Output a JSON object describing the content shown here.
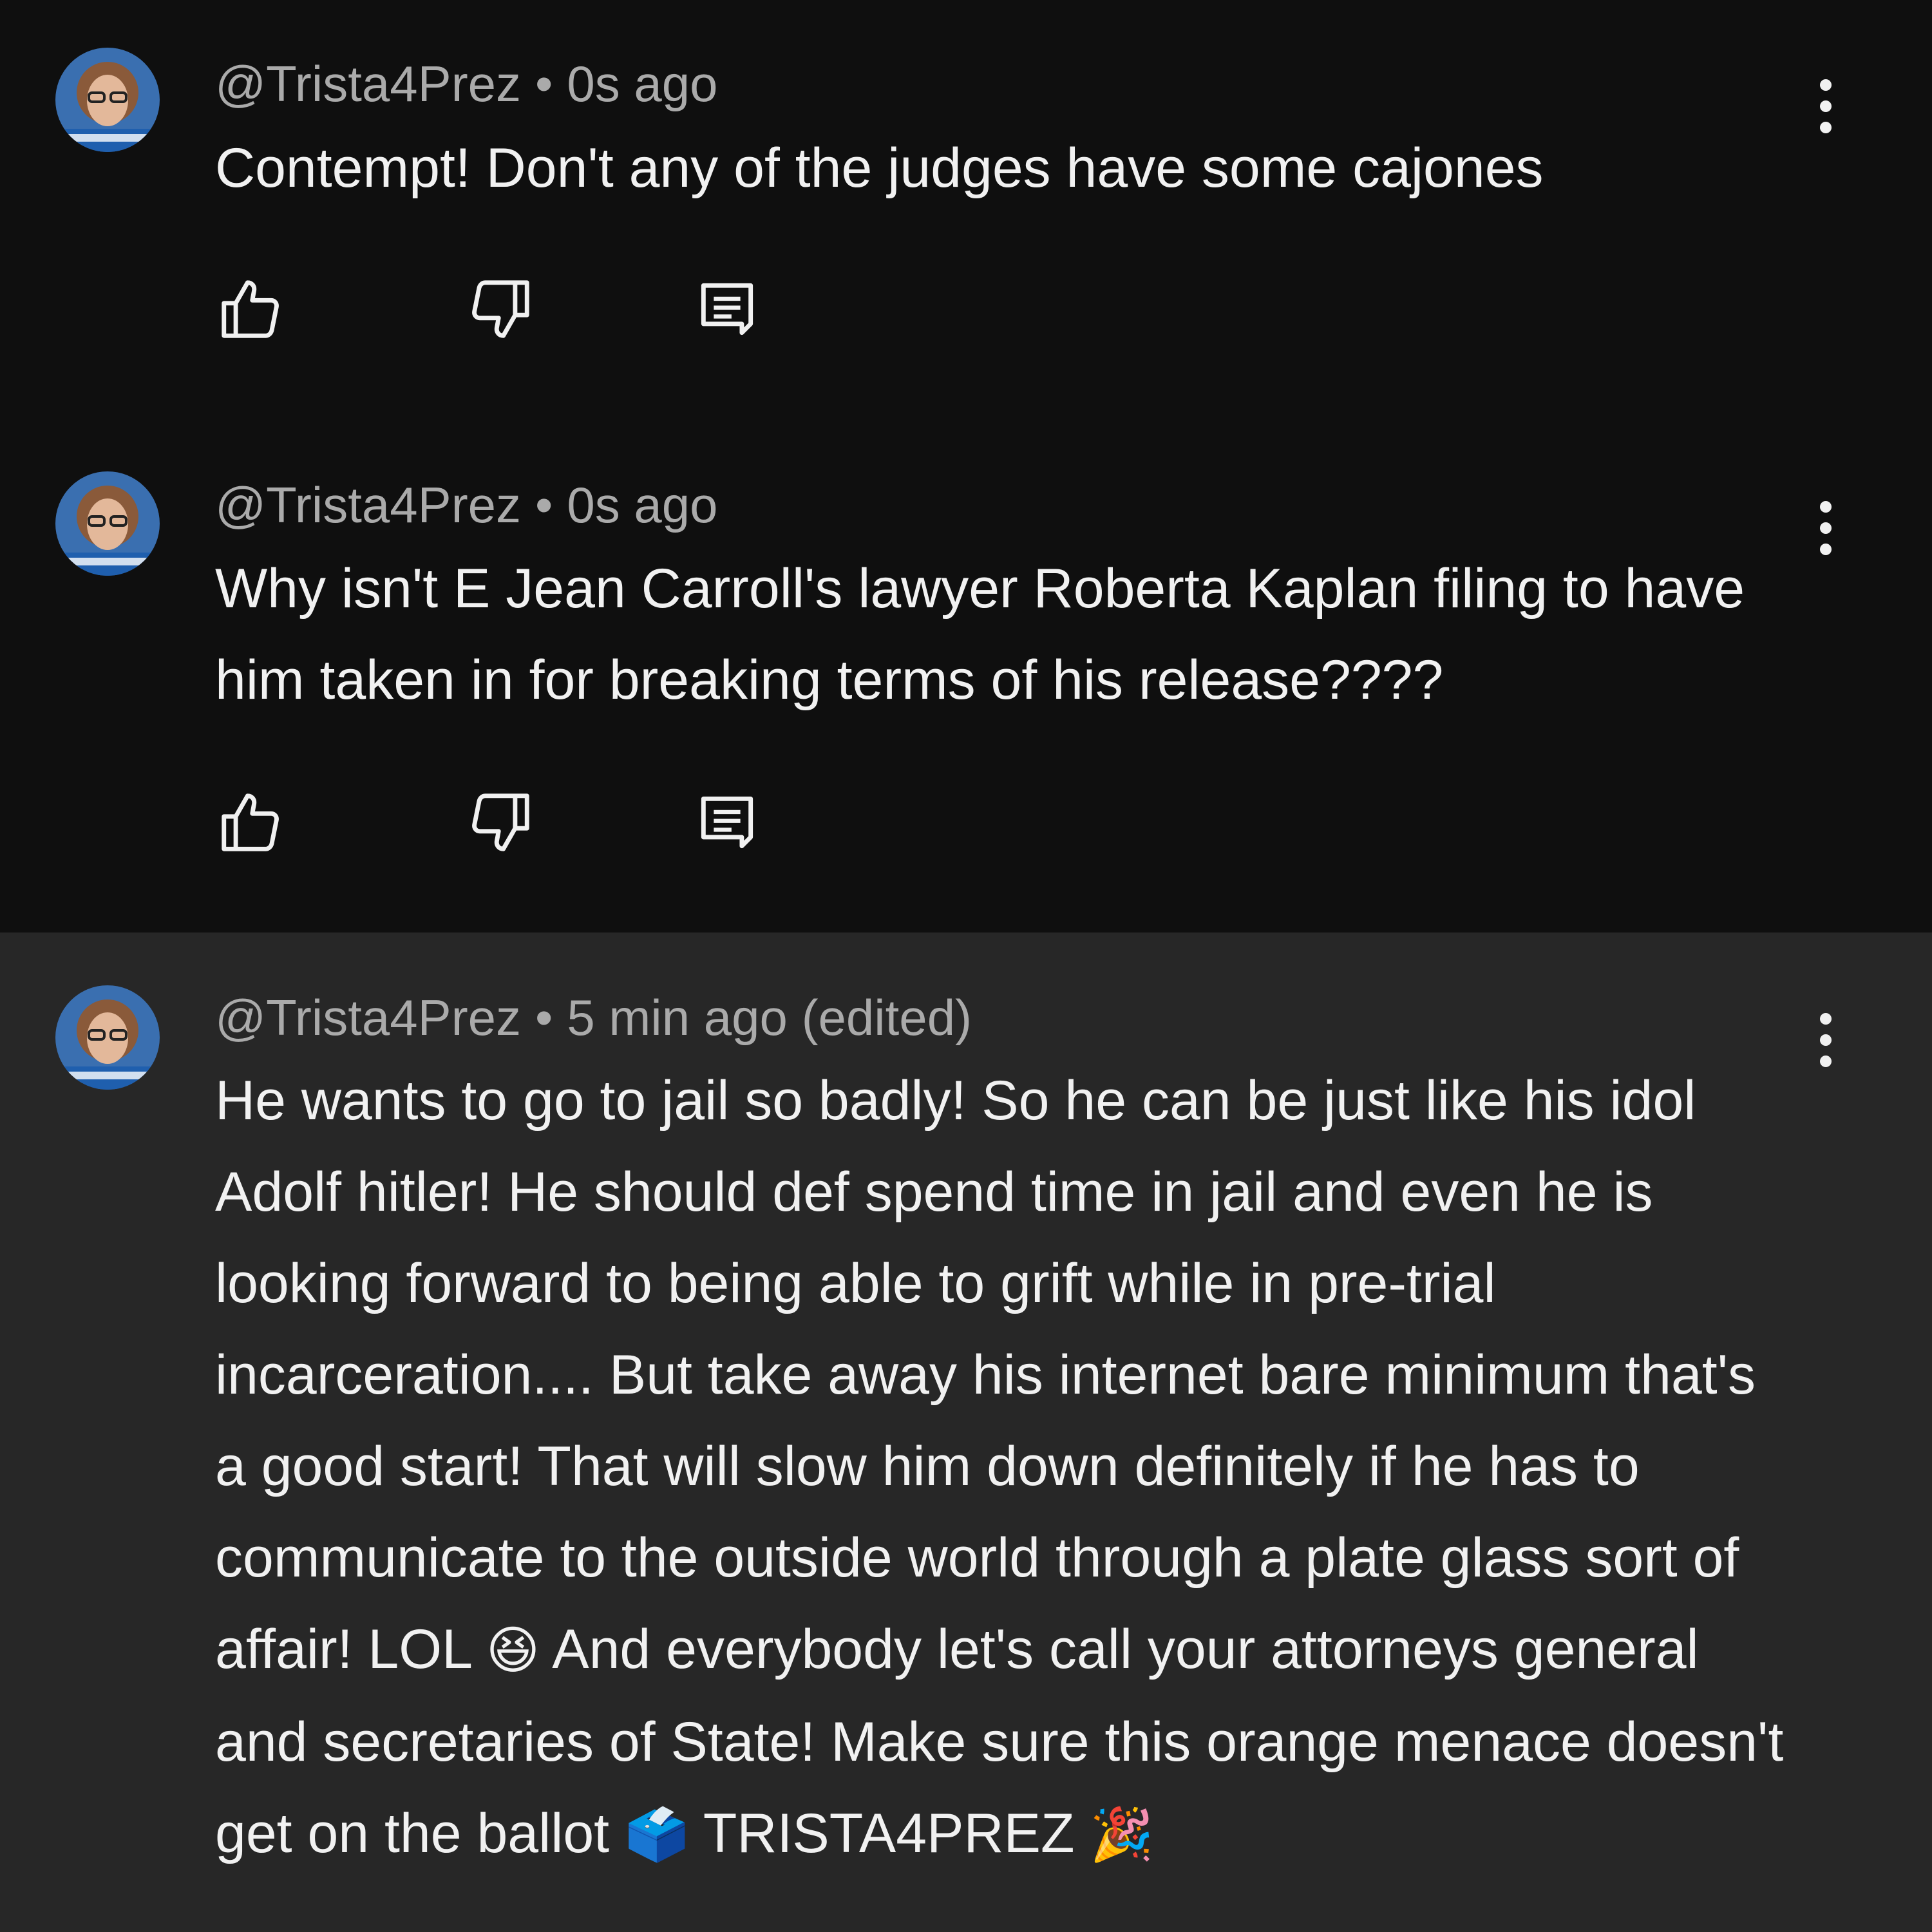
{
  "comments": [
    {
      "handle": "@Trista4Prez",
      "separator": "•",
      "time": "0s ago",
      "text": "Contempt! Don't any of the judges have some cajones"
    },
    {
      "handle": "@Trista4Prez",
      "separator": "•",
      "time": "0s ago",
      "text": "Why isn't E Jean Carroll's lawyer Roberta Kaplan filing to have him taken in for breaking terms of his release????"
    },
    {
      "handle": "@Trista4Prez",
      "separator": "•",
      "time": "5 min ago (edited)",
      "text_part1": "He wants to go to jail so badly! So he can be just like his idol Adolf hitler! He should def spend time in jail and even he is looking forward to being able to grift while in pre-trial incarceration.... But take away his internet bare minimum that's a good start! That will slow him down definitely if he has to communicate to the outside world through a plate glass sort of affair! LOL ",
      "emoji1": "😆",
      "text_part2": " And everybody let's call your attorneys general and secretaries of State! Make sure this orange menace doesn't get on the ballot ",
      "emoji2": "🗳️",
      "text_part3": " TRISTA4PREZ ",
      "emoji3": "🎉"
    }
  ],
  "colors": {
    "background": "#0f0f0f",
    "highlight_background": "#272727",
    "primary_text": "#f1f1f1",
    "secondary_text": "#aaaaaa"
  },
  "icons": {
    "like": "thumbs-up-icon",
    "dislike": "thumbs-down-icon",
    "reply": "reply-comment-icon",
    "menu": "more-vert-icon"
  }
}
